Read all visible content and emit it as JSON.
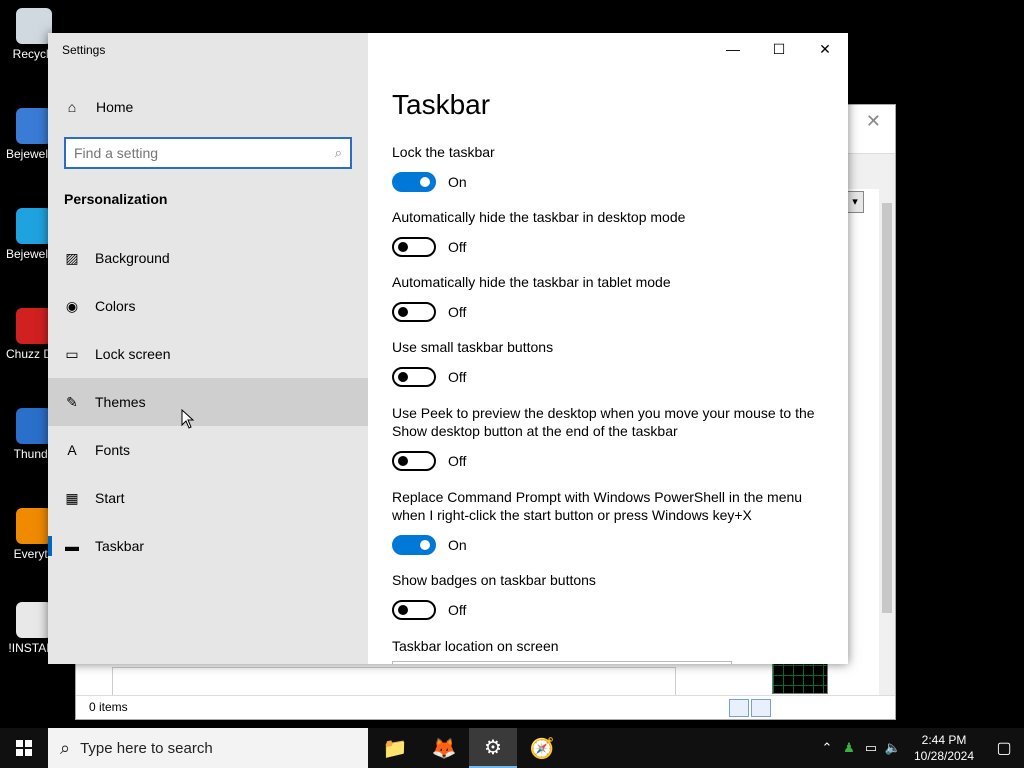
{
  "desktop": {
    "icons": [
      {
        "label": "Recycle",
        "icon": "recycle-bin-icon",
        "color": "#d0d8e0"
      },
      {
        "label": "Bejewel Delux",
        "icon": "bejeweled-icon",
        "color": "#3a7bd5"
      },
      {
        "label": "Bejewel Delux",
        "icon": "bejeweled-2-icon",
        "color": "#1fa3e0"
      },
      {
        "label": "Chuzz Delux",
        "icon": "chuzzle-icon",
        "color": "#d02020"
      },
      {
        "label": "Thunde",
        "icon": "thunderbird-icon",
        "color": "#2a6fc9"
      },
      {
        "label": "Everyth",
        "icon": "everything-search-icon",
        "color": "#f08a00"
      },
      {
        "label": "!INSTALL",
        "icon": "text-file-icon",
        "color": "#e8e8e8"
      }
    ]
  },
  "background_window": {
    "status": "0 items"
  },
  "settings": {
    "window_title": "Settings",
    "controls": {
      "minimize": "—",
      "maximize": "☐",
      "close": "✕"
    },
    "home_label": "Home",
    "search_placeholder": "Find a setting",
    "section_title": "Personalization",
    "nav": [
      {
        "label": "Background",
        "icon": "picture-icon",
        "glyph": "▨"
      },
      {
        "label": "Colors",
        "icon": "palette-icon",
        "glyph": "◉"
      },
      {
        "label": "Lock screen",
        "icon": "lock-screen-icon",
        "glyph": "▭"
      },
      {
        "label": "Themes",
        "icon": "themes-icon",
        "glyph": "✎"
      },
      {
        "label": "Fonts",
        "icon": "fonts-icon",
        "glyph": "A"
      },
      {
        "label": "Start",
        "icon": "start-icon",
        "glyph": "▦"
      },
      {
        "label": "Taskbar",
        "icon": "taskbar-icon",
        "glyph": "▬"
      }
    ],
    "page_title": "Taskbar",
    "options": [
      {
        "label": "Lock the taskbar",
        "state": "On",
        "on": true
      },
      {
        "label": "Automatically hide the taskbar in desktop mode",
        "state": "Off",
        "on": false
      },
      {
        "label": "Automatically hide the taskbar in tablet mode",
        "state": "Off",
        "on": false
      },
      {
        "label": "Use small taskbar buttons",
        "state": "Off",
        "on": false
      },
      {
        "label": "Use Peek to preview the desktop when you move your mouse to the Show desktop button at the end of the taskbar",
        "state": "Off",
        "on": false
      },
      {
        "label": "Replace Command Prompt with Windows PowerShell in the menu when I right-click the start button or press Windows key+X",
        "state": "On",
        "on": true
      },
      {
        "label": "Show badges on taskbar buttons",
        "state": "Off",
        "on": false
      }
    ],
    "location_label": "Taskbar location on screen"
  },
  "taskbar": {
    "search_placeholder": "Type here to search",
    "apps": [
      {
        "name": "file-explorer-icon",
        "glyph": "📁"
      },
      {
        "name": "firefox-icon",
        "glyph": "🦊"
      },
      {
        "name": "settings-gear-icon",
        "glyph": "⚙"
      },
      {
        "name": "compass-app-icon",
        "glyph": "🧭"
      }
    ],
    "time": "2:44 PM",
    "date": "10/28/2024"
  },
  "colors": {
    "accent": "#0078d7",
    "sidebar": "#e6e6e6",
    "hover": "#cfcfcf"
  }
}
